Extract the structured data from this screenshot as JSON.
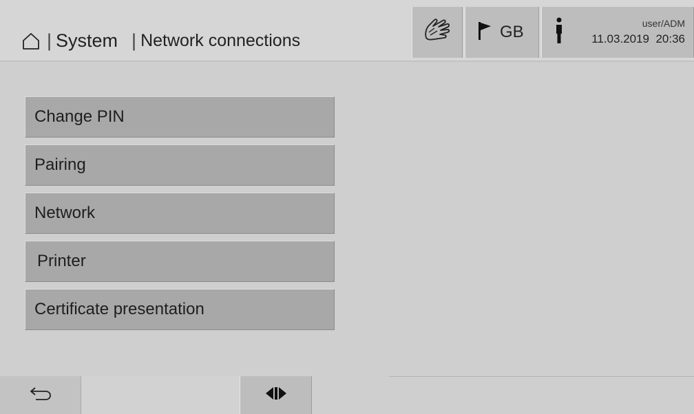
{
  "header": {
    "breadcrumb": {
      "home_icon": "home-icon",
      "separator": "|",
      "section": "System",
      "current": "Network connections"
    },
    "buttons": {
      "hand_icon": "hand-tap-icon",
      "flag_icon": "flag-icon",
      "language": "GB",
      "person_icon": "person-icon",
      "user": "user/ADM",
      "datetime": "11.03.2019  20:36"
    }
  },
  "menu": {
    "items": [
      {
        "label": "Change PIN"
      },
      {
        "label": "Pairing"
      },
      {
        "label": "Network"
      },
      {
        "label": "Printer"
      },
      {
        "label": "Certificate presentation"
      }
    ]
  },
  "footer": {
    "back_icon": "back-arrow-icon",
    "split_icon": "split-view-icon"
  },
  "colors": {
    "background": "#cfcfcf",
    "button": "#a8a8a8",
    "header_button": "#bdbdbd"
  }
}
